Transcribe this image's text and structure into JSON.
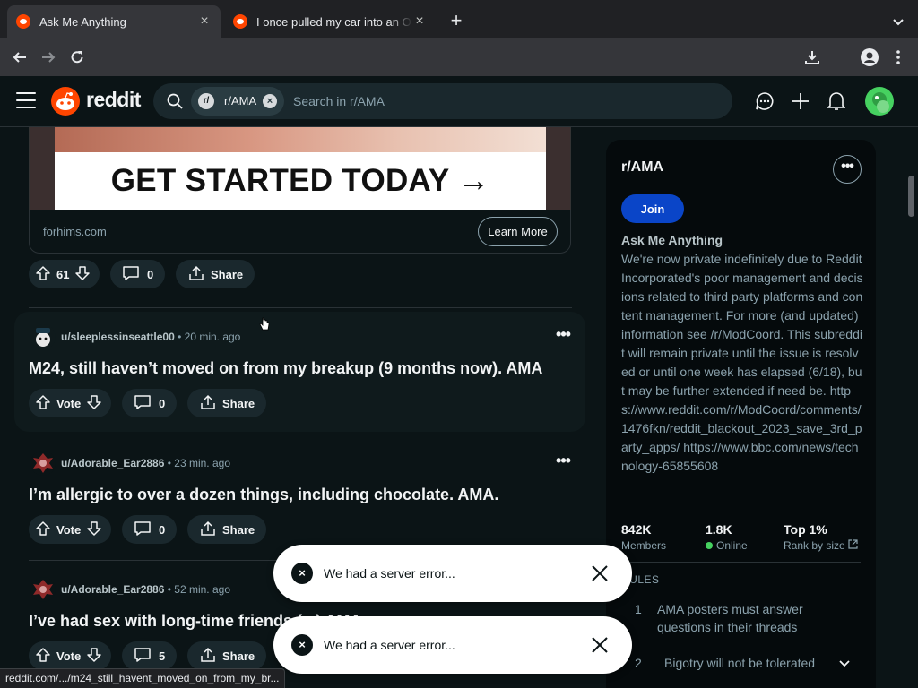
{
  "browser": {
    "tabs": [
      {
        "title": "Ask Me Anything",
        "close": "×"
      },
      {
        "title": "I once pulled my car into an O",
        "close": "×"
      }
    ],
    "new_tab": "+",
    "status_url": "reddit.com/.../m24_still_havent_moved_on_from_my_br..."
  },
  "header": {
    "brand": "reddit",
    "search": {
      "chip_label": "r/AMA",
      "chip_icon": "r/",
      "placeholder": "Search in r/AMA"
    }
  },
  "ad": {
    "banner_text": "GET STARTED TODAY →",
    "domain": "forhims.com",
    "cta": "Learn More",
    "votes": "61",
    "comments": "0",
    "share": "Share"
  },
  "posts": [
    {
      "user": "u/sleeplessinseattle00",
      "sep": "•",
      "time": "20 min. ago",
      "title": "M24, still haven’t moved on from my breakup (9 months now). AMA",
      "vote": "Vote",
      "comments": "0",
      "share": "Share",
      "more": "•••"
    },
    {
      "user": "u/Adorable_Ear2886",
      "sep": "•",
      "time": "23 min. ago",
      "title": "I’m allergic to over a dozen things, including chocolate. AMA.",
      "vote": "Vote",
      "comments": "0",
      "share": "Share",
      "more": "•••"
    },
    {
      "user": "u/Adorable_Ear2886",
      "sep": "•",
      "time": "52 min. ago",
      "title": "I’ve had sex with long-time friends (...) AMA",
      "vote": "Vote",
      "comments": "5",
      "share": "Share",
      "more": "•••"
    }
  ],
  "sidebar": {
    "title": "r/AMA",
    "more": "•••",
    "join": "Join",
    "name": "Ask Me Anything",
    "description": "We're now private indefinitely due to Reddit Incorporated's poor management and decisions related to third party platforms and content management. For more (and updated) information see /r/ModCoord. This subreddit will remain private until the issue is resolved or until one week has elapsed (6/18), but may be further extended if need be. https://www.reddit.com/r/ModCoord/comments/1476fkn/reddit_blackout_2023_save_3rd_party_apps/ https://www.bbc.com/news/technology-65855608",
    "stats": [
      {
        "value": "842K",
        "label": "Members"
      },
      {
        "value": "1.8K",
        "label": "Online"
      },
      {
        "value": "Top 1%",
        "label": "Rank by size"
      }
    ],
    "rules_header": "RULES",
    "rules": [
      {
        "num": "1",
        "text": "AMA posters must answer questions in their threads"
      },
      {
        "num": "2",
        "text": "Bigotry will not be tolerated"
      }
    ]
  },
  "toasts": [
    {
      "message": "We had a server error...",
      "icon": "×"
    },
    {
      "message": "We had a server error...",
      "icon": "×"
    }
  ],
  "colors": {
    "reddit_orange": "#ff4500",
    "join_blue": "#0a45c8",
    "online_green": "#46d160",
    "bg": "#0b1416"
  }
}
